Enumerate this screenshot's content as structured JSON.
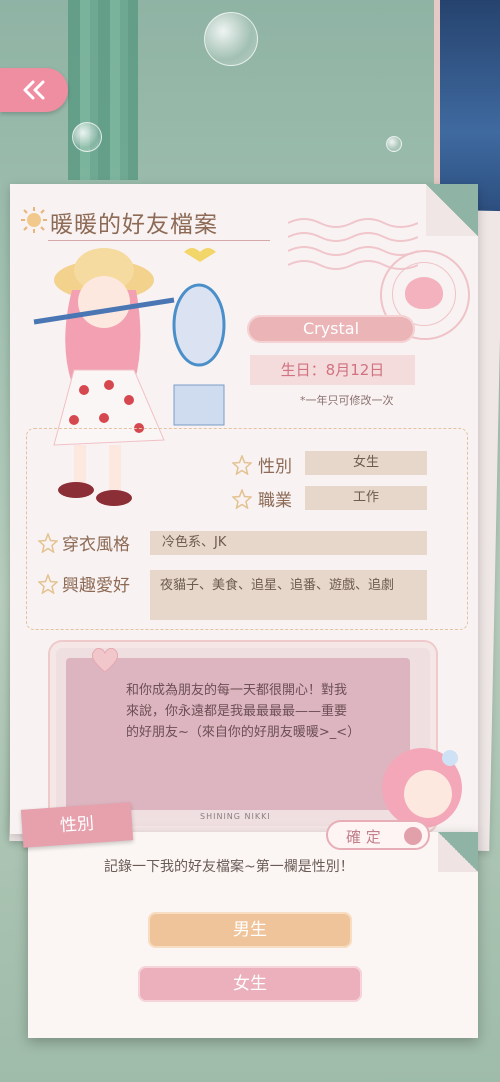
{
  "profile": {
    "title": "暖暖的好友檔案",
    "name": "Crystal",
    "birthday": "生日：8月12日",
    "birthday_note": "*一年只可修改一次",
    "fields": {
      "gender_label": "性別",
      "gender_value": "女生",
      "job_label": "職業",
      "job_value": "工作",
      "style_label": "穿衣風格",
      "style_value": "冷色系、JK",
      "hobby_label": "興趣愛好",
      "hobby_value": "夜貓子、美食、追星、追番、遊戲、追劇"
    },
    "message": "和你成為朋友的每一天都很開心！對我來說，你永遠都是我最最最最——重要的好朋友~（來自你的好朋友暖暖>_<）",
    "signature": "SHINING NIKKI"
  },
  "dialog": {
    "tag": "性別",
    "confirm_label": "確 定",
    "prompt": "記錄一下我的好友檔案~第一欄是性別！",
    "options": [
      "男生",
      "女生"
    ]
  },
  "colors": {
    "accent_pink": "#ebb0bb",
    "accent_orange": "#f0c49a",
    "title_brown": "#8d6a55"
  }
}
